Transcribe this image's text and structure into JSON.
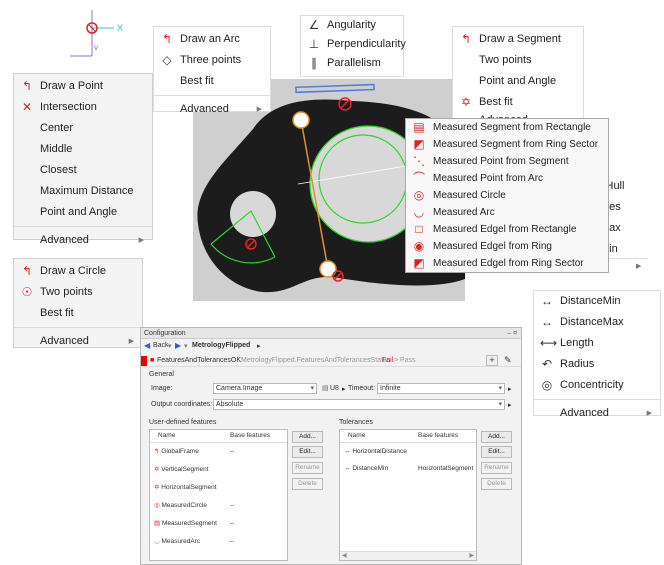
{
  "arc_menu": {
    "title": "Draw an Arc",
    "items": [
      "Three points",
      "Best fit",
      "Advanced"
    ]
  },
  "relation_menu": {
    "items": [
      "Angularity",
      "Perpendicularity",
      "Parallelism"
    ]
  },
  "segment_menu": {
    "title": "Draw a Segment",
    "items": [
      "Two points",
      "Point and Angle",
      "Best fit",
      "Advanced"
    ]
  },
  "point_menu": {
    "title": "Draw a Point",
    "items": [
      "Intersection",
      "Center",
      "Middle",
      "Closest",
      "Maximum Distance",
      "Point and Angle",
      "Advanced"
    ]
  },
  "circle_menu": {
    "title": "Draw a Circle",
    "items": [
      "Two points",
      "Best fit",
      "Advanced"
    ]
  },
  "measured_menu": {
    "items": [
      "Measured Segment from Rectangle",
      "Measured Segment from Ring Sector",
      "Measured Point from Segment",
      "Measured Point from Arc",
      "Measured Circle",
      "Measured Arc",
      "Measured Edgel from Rectangle",
      "Measured Edgel from Ring",
      "Measured Edgel from Ring Sector"
    ]
  },
  "partial_right": [
    "xHull",
    "rves",
    "Max",
    "Min"
  ],
  "distance_menu": {
    "items": [
      "DistanceMin",
      "DistanceMax",
      "Length",
      "Radius",
      "Concentricity",
      "Advanced"
    ]
  },
  "axis_label": "X",
  "config": {
    "title": "Configuration",
    "pin": "– ¤",
    "back": "Back",
    "program": "MetrologyFlipped",
    "status_name": "FeaturesAndTolerancesOK",
    "status_path": "MetrologyFlipped.FeaturesAndTolerancesStatus",
    "fail": "Fail",
    "pass_sep": "> Pass",
    "general": "General",
    "image_label": "Image:",
    "image_value": "Camera.Image",
    "u8": "U8",
    "timeout_label": "Timeout:",
    "timeout_value": "Infinite",
    "output_label": "Output coordinates:",
    "output_value": "Absolute",
    "features_label": "User-defined features",
    "tolerances_label": "Tolerances",
    "col_name": "Name",
    "col_base": "Base features",
    "features": [
      {
        "name": "GlobalFrame",
        "base": "--"
      },
      {
        "name": "VerticalSegment",
        "base": ""
      },
      {
        "name": "HorizontalSegment",
        "base": ""
      },
      {
        "name": "MeasuredCircle",
        "base": "--"
      },
      {
        "name": "MeasuredSegment",
        "base": "--"
      },
      {
        "name": "MeasuredArc",
        "base": "--"
      }
    ],
    "tolerances": [
      {
        "name": "HorizontalDistance",
        "base": ""
      },
      {
        "name": "DistanceMin",
        "base": "HorizontalSegment"
      }
    ],
    "buttons": [
      "Add...",
      "Edit...",
      "Rename",
      "Delete"
    ]
  }
}
